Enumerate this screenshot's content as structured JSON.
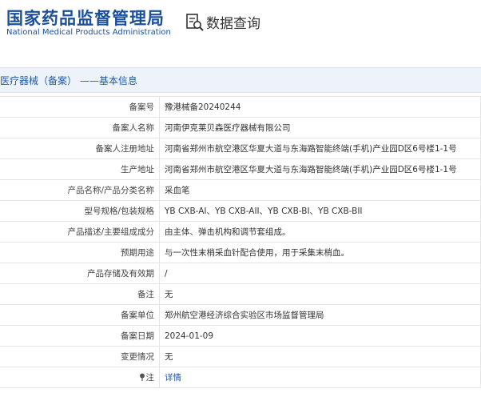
{
  "header": {
    "logo_cn": "国家药品监督管理局",
    "logo_en": "National Medical Products Administration",
    "search_title": "数据查询",
    "search_icon": "database-search-icon"
  },
  "section": {
    "title": "医疗器械（备案） ——基本信息"
  },
  "rows": [
    {
      "label": "备案号",
      "value": "豫港械备20240244"
    },
    {
      "label": "备案人名称",
      "value": "河南伊克莱贝森医疗器械有限公司"
    },
    {
      "label": "备案人注册地址",
      "value": "河南省郑州市航空港区华夏大道与东海路智能终端(手机)产业园D区6号楼1-1号"
    },
    {
      "label": "生产地址",
      "value": "河南省郑州市航空港区华夏大道与东海路智能终端(手机)产业园D区6号楼1-1号"
    },
    {
      "label": "产品名称/产品分类名称",
      "value": "采血笔"
    },
    {
      "label": "型号规格/包装规格",
      "value": "YB CXB-AI、YB CXB-AII、YB CXB-BI、YB CXB-BII"
    },
    {
      "label": "产品描述/主要组成成分",
      "value": "由主体、弹击机构和调节套组成。"
    },
    {
      "label": "预期用途",
      "value": "与一次性末梢采血针配合使用，用于采集末梢血。"
    },
    {
      "label": "产品存储及有效期",
      "value": "/"
    },
    {
      "label": "备注",
      "value": "无"
    },
    {
      "label": "备案单位",
      "value": "郑州航空港经济综合实验区市场监督管理局"
    },
    {
      "label": "备案日期",
      "value": "2024-01-09"
    },
    {
      "label": "变更情况",
      "value": "无"
    },
    {
      "label": "注",
      "value": "详情"
    }
  ],
  "colors": {
    "brand_blue": "#1a4f9c",
    "link_blue": "#1f5aa8",
    "section_bg": "#eef3fa"
  }
}
